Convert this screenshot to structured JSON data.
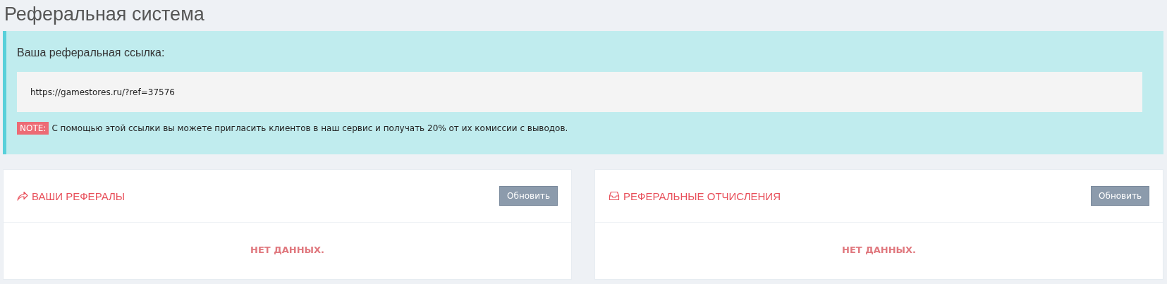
{
  "page_title": "Реферальная система",
  "referral": {
    "label": "Ваша реферальная ссылка:",
    "link": "https://gamestores.ru/?ref=37576",
    "note_tag": "NOTE:",
    "note_text": "С помощью этой ссылки вы можете пригласить клиентов в наш сервис и получать 20% от их комиссии с выводов."
  },
  "panels": [
    {
      "kind": "share",
      "title": "ВАШИ РЕФЕРАЛЫ",
      "button": "Обновить",
      "empty_text": "НЕТ ДАННЫХ."
    },
    {
      "kind": "inbox",
      "title": "РЕФЕРАЛЬНЫЕ ОТЧИСЛЕНИЯ",
      "button": "Обновить",
      "empty_text": "НЕТ ДАННЫХ."
    }
  ]
}
